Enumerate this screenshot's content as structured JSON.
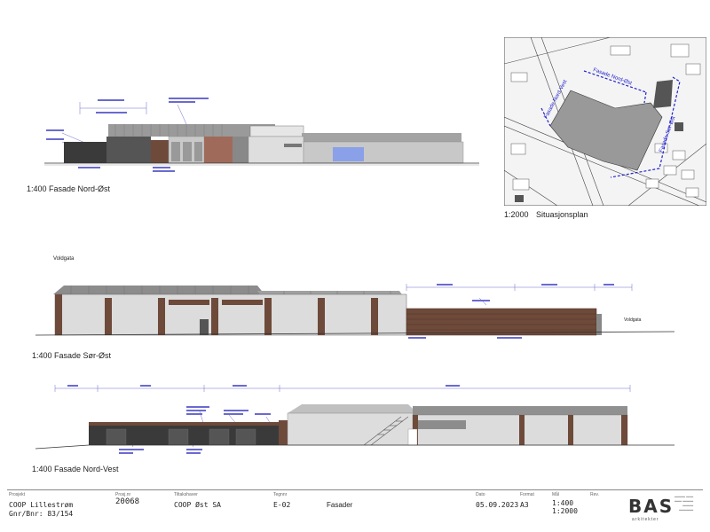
{
  "views": {
    "nord_ost": {
      "label": "1:400  Fasade Nord-Øst"
    },
    "sor_ost": {
      "label": "1:400  Fasade Sør-Øst",
      "street": "Voldgata",
      "street_right": "Voldgata"
    },
    "nord_vest": {
      "label": "1:400 Fasade Nord-Vest"
    },
    "situasjonsplan": {
      "scale": "1:2000",
      "title": "Situasjonsplan"
    }
  },
  "title_block": {
    "prosjekt_caption": "Prosjekt",
    "prosjekt_line1": "COOP Lillestrøm",
    "prosjekt_line2": "Gnr/Bnr: 83/154",
    "prosjnr_caption": "Prosj.nr",
    "prosjnr": "20068",
    "tiltakshaver_caption": "Tiltakshaver",
    "tiltakshaver": "COOP Øst SA",
    "tegnnr_caption": "Tegnnr",
    "tegnnr": "E-02",
    "tittel": "Fasader",
    "dato_caption": "Dato",
    "dato": "05.09.2023",
    "format_caption": "Format",
    "format": "A3",
    "maal_caption": "Mål",
    "maal_1": "1:400",
    "maal_2": "1:2000",
    "rev_caption": "Rev.",
    "logo": "BAS",
    "logo_sub": "arkitekter"
  },
  "colors": {
    "wall_grey": "#dcdcdc",
    "roof_grey": "#8c8c8c",
    "brown": "#6e4a3a",
    "dark": "#3a3a3a",
    "blue": "#8aa0e8",
    "plan_line": "#2222cc"
  }
}
